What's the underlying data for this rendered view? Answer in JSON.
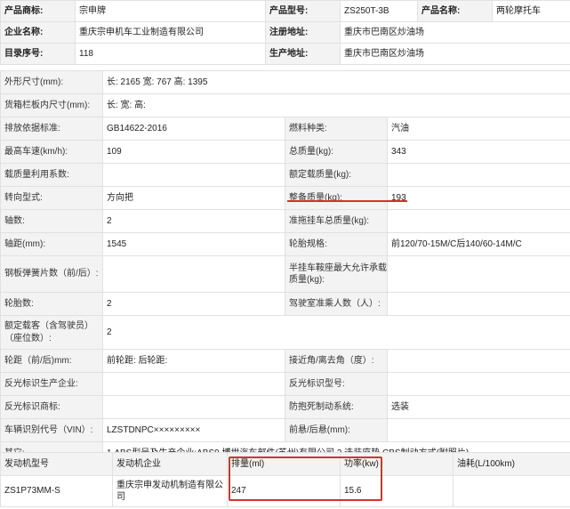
{
  "top": {
    "brand_label": "产品商标:",
    "brand_value": "宗申牌",
    "model_label": "产品型号:",
    "model_value": "ZS250T-3B",
    "name_label": "产品名称:",
    "name_value": "两轮摩托车",
    "company_label": "企业名称:",
    "company_value": "重庆宗申机车工业制造有限公司",
    "reg_addr_label": "注册地址:",
    "reg_addr_value": "重庆市巴南区炒油场",
    "catalog_label": "目录序号:",
    "catalog_value": "118",
    "prod_addr_label": "生产地址:",
    "prod_addr_value": "重庆市巴南区炒油场"
  },
  "spec": [
    [
      "外形尺寸(mm):",
      "长: 2165 宽: 767 高: 1395",
      null,
      null
    ],
    [
      "货箱栏板内尺寸(mm):",
      "长:  宽:  高:",
      null,
      null
    ],
    [
      "排放依据标准:",
      "GB14622-2016",
      "燃料种类:",
      "汽油"
    ],
    [
      "最高车速(km/h):",
      "109",
      "总质量(kg):",
      "343"
    ],
    [
      "载质量利用系数:",
      "",
      "额定载质量(kg):",
      ""
    ],
    [
      "转向型式:",
      "方向把",
      "整备质量(kg):",
      "193"
    ],
    [
      "轴数:",
      "2",
      "准拖挂车总质量(kg):",
      ""
    ],
    [
      "轴距(mm):",
      "1545",
      "轮胎规格:",
      "前120/70-15M/C后140/60-14M/C"
    ],
    [
      "钢板弹簧片数（前/后）:",
      "",
      "半挂车鞍座最大允许承载质量(kg):",
      ""
    ],
    [
      "轮胎数:",
      "2",
      "驾驶室准乘人数（人）:",
      ""
    ],
    [
      "额定载客（含驾驶员）（座位数）:",
      "2",
      null,
      null
    ],
    [
      "轮距（前/后)mm:",
      "前轮距: 后轮距:",
      "接近角/离去角（度）:",
      ""
    ],
    [
      "反光标识生产企业:",
      "",
      "反光标识型号:",
      ""
    ],
    [
      "反光标识商标:",
      "",
      "防抱死制动系统:",
      "选装"
    ],
    [
      "车辆识别代号（VIN）:",
      "LZSTDNPC×××××××××",
      "前悬/后悬(mm):",
      ""
    ],
    [
      "其它:",
      "1.ABS型号及生产企业:ABS9,博世汽车部件(苏州)有限公司,2.选装座垫,CBS制动方式(附照片)",
      null,
      null
    ]
  ],
  "engine": {
    "headers": [
      "发动机型号",
      "发动机企业",
      "排量(ml)",
      "功率(kw)",
      "油耗(L/100km)"
    ],
    "row": [
      "ZS1P73MM-S",
      "重庆宗申发动机制造有限公司",
      "247",
      "15.6",
      ""
    ]
  }
}
